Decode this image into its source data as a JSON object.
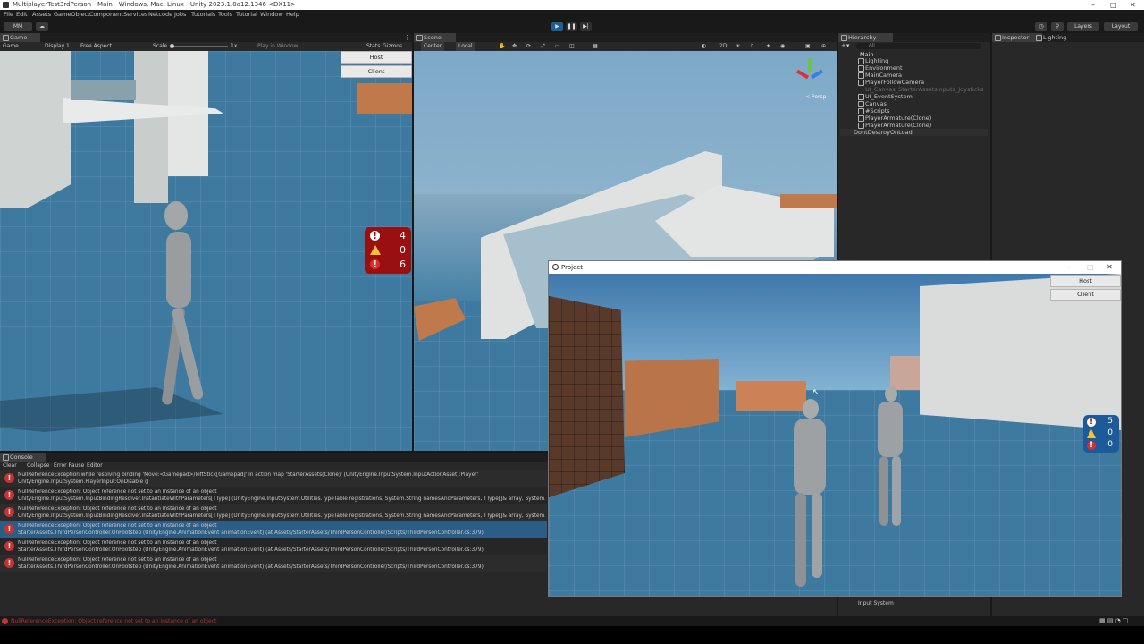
{
  "window": {
    "title": "MultiplayerTest3rdPerson - Main - Windows, Mac, Linux - Unity 2023.1.0a12.1346 <DX11>",
    "controls": [
      "–",
      "□",
      "✕"
    ]
  },
  "menu": [
    "File",
    "Edit",
    "Assets",
    "GameObject",
    "Component",
    "Services",
    "Netcode",
    "Jobs",
    "Tutorials",
    "Tools",
    "Tutorial",
    "Window",
    "Help"
  ],
  "toolbar": {
    "account": "MM",
    "cloud": "☁",
    "play": "▶",
    "pause": "❚❚",
    "step": "▶|",
    "layers": "Layers",
    "layout": "Layout"
  },
  "game_panel": {
    "tab": "Game",
    "mode": "Game",
    "display": "Display 1",
    "aspect": "Free Aspect",
    "scale_label": "Scale",
    "scale_value": "1x",
    "play_mode": "Play in Window",
    "stats": "Stats",
    "gizmos": "Gizmos",
    "host": "Host",
    "client": "Client",
    "counts": {
      "info": "4",
      "warning": "0",
      "error": "6"
    }
  },
  "scene_panel": {
    "tab": "Scene",
    "center": "Center",
    "local": "Local",
    "mode_2d": "2D",
    "persp": "< Persp"
  },
  "hierarchy": {
    "tab": "Hierarchy",
    "search": "All",
    "scene": "Main",
    "items": [
      "Lighting",
      "Environment",
      "MainCamera",
      "PlayerFollowCamera",
      "UI_Canvas_StarterAssetsInputs_Joysticks",
      "UI_EventSystem",
      "Canvas",
      "#Scripts",
      "PlayerArmature(Clone)",
      "PlayerArmature(Clone)"
    ],
    "dont_destroy": "DontDestroyOnLoad"
  },
  "inspector": {
    "tab": "Inspector",
    "lighting_tab": "Lighting"
  },
  "project_footer": {
    "package": "package",
    "input_system": "Input System"
  },
  "console": {
    "tab": "Console",
    "clear": "Clear",
    "collapse": "Collapse",
    "error_pause": "Error Pause",
    "editor": "Editor",
    "rows": [
      {
        "l1": "NullReferenceException while resolving binding 'Move:<Gamepad>/leftStick[Gamepad]' in action map 'StarterAssets(Clone)' (UnityEngine.InputSystem.InputActionAsset):Player'",
        "l2": "UnityEngine.InputSystem.PlayerInput:OnDisable ()"
      },
      {
        "l1": "NullReferenceException: Object reference not set to an instance of an object",
        "l2": "UnityEngine.InputSystem.InputBindingResolver.InstantiateWithParameters[TType] (UnityEngine.InputSystem.Utilities.TypeTable registrations, System.String namesAndParameters, TType[]& array, System.Int32& c"
      },
      {
        "l1": "NullReferenceException: Object reference not set to an instance of an object",
        "l2": "UnityEngine.InputSystem.InputBindingResolver.InstantiateWithParameters[TType] (UnityEngine.InputSystem.Utilities.TypeTable registrations, System.String namesAndParameters, TType[]& array, System.Int32& c"
      },
      {
        "l1": "NullReferenceException: Object reference not set to an instance of an object",
        "l2": "StarterAssets.ThirdPersonController.OnFootstep (UnityEngine.AnimationEvent animationEvent) (at Assets/StarterAssets/ThirdPersonController/Scripts/ThirdPersonController.cs:379)"
      },
      {
        "l1": "NullReferenceException: Object reference not set to an instance of an object",
        "l2": "StarterAssets.ThirdPersonController.OnFootstep (UnityEngine.AnimationEvent animationEvent) (at Assets/StarterAssets/ThirdPersonController/Scripts/ThirdPersonController.cs:379)"
      },
      {
        "l1": "NullReferenceException: Object reference not set to an instance of an object",
        "l2": "StarterAssets.ThirdPersonController.OnFootstep (UnityEngine.AnimationEvent animationEvent) (at Assets/StarterAssets/ThirdPersonController/Scripts/ThirdPersonController.cs:379)"
      }
    ],
    "status": "NullReferenceException: Object reference not set to an instance of an object"
  },
  "project_window": {
    "title": "Project",
    "host": "Host",
    "client": "Client",
    "counts": {
      "info": "5",
      "warning": "0",
      "error": "0"
    }
  },
  "colors": {
    "error_red": "#c83232",
    "badge_red": "#9a1010",
    "badge_blue": "#1c5a99",
    "selection": "#2c5d87"
  }
}
